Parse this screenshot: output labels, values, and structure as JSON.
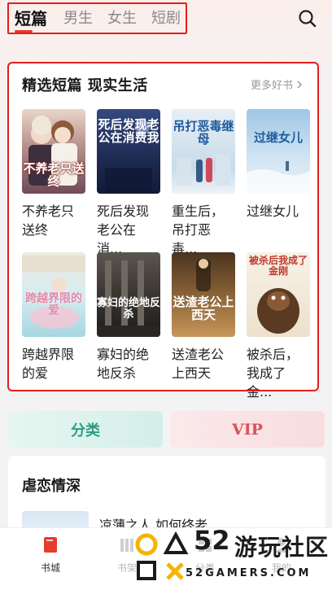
{
  "tabs": [
    {
      "label": "短篇",
      "active": true
    },
    {
      "label": "男生",
      "active": false
    },
    {
      "label": "女生",
      "active": false
    },
    {
      "label": "短剧",
      "active": false
    }
  ],
  "search_icon": "search-icon",
  "section": {
    "title": "精选短篇 现实生活",
    "more_label": "更多好书",
    "books": [
      {
        "title": "不养老只送终",
        "cover_text": "不养老只送终",
        "cover_color": "#c9b7b0"
      },
      {
        "title": "死后发现老公在消费我",
        "cover_text": "死后发现老公在消费我",
        "cover_color": "#1f2f5c"
      },
      {
        "title": "重生后，吊打恶毒继母",
        "cover_text": "吊打恶毒继母",
        "cover_color": "#cfe0ee"
      },
      {
        "title": "过继女儿",
        "cover_text": "过继女儿",
        "cover_color": "#b6d4ec"
      },
      {
        "title": "跨越界限的爱",
        "cover_text": "跨越界限的爱",
        "cover_color": "#d9ecf2"
      },
      {
        "title": "寡妇的绝地反杀",
        "cover_text": "寡妇的绝地反杀",
        "cover_color": "#3a3532"
      },
      {
        "title": "送渣老公上西天",
        "cover_text": "送渣老公上西天",
        "cover_color": "#7a5530"
      },
      {
        "title": "被杀后，我成了金刚",
        "cover_text": "被杀后我成了金刚",
        "cover_color": "#f2ece0"
      }
    ],
    "book_titles_display": [
      "不养老只送终",
      "死后发现老公在消...",
      "重生后，吊打恶毒...",
      "过继女儿",
      "跨越界限的爱",
      "寡妇的绝地反杀",
      "送渣老公上西天",
      "被杀后，我成了金..."
    ]
  },
  "buttons": {
    "category_label": "分类",
    "vip_label": "VIP"
  },
  "section2": {
    "title": "虐恋情深",
    "item_text": "凉薄之人    如何终老"
  },
  "bottom_nav": [
    {
      "label": "书城",
      "icon": "book-icon",
      "active": true
    },
    {
      "label": "书架",
      "icon": "shelf-icon",
      "active": false
    },
    {
      "label": "分类",
      "icon": "category-icon",
      "active": false
    },
    {
      "label": "我的",
      "icon": "profile-icon",
      "active": false
    }
  ],
  "watermark": {
    "brand": "52",
    "name": "游玩社区",
    "url": "52GAMERS.COM"
  },
  "colors": {
    "accent": "#e53c2c",
    "highlight_box": "#e51d1d",
    "teal": "#2b9c84",
    "vip": "#d9515c"
  }
}
